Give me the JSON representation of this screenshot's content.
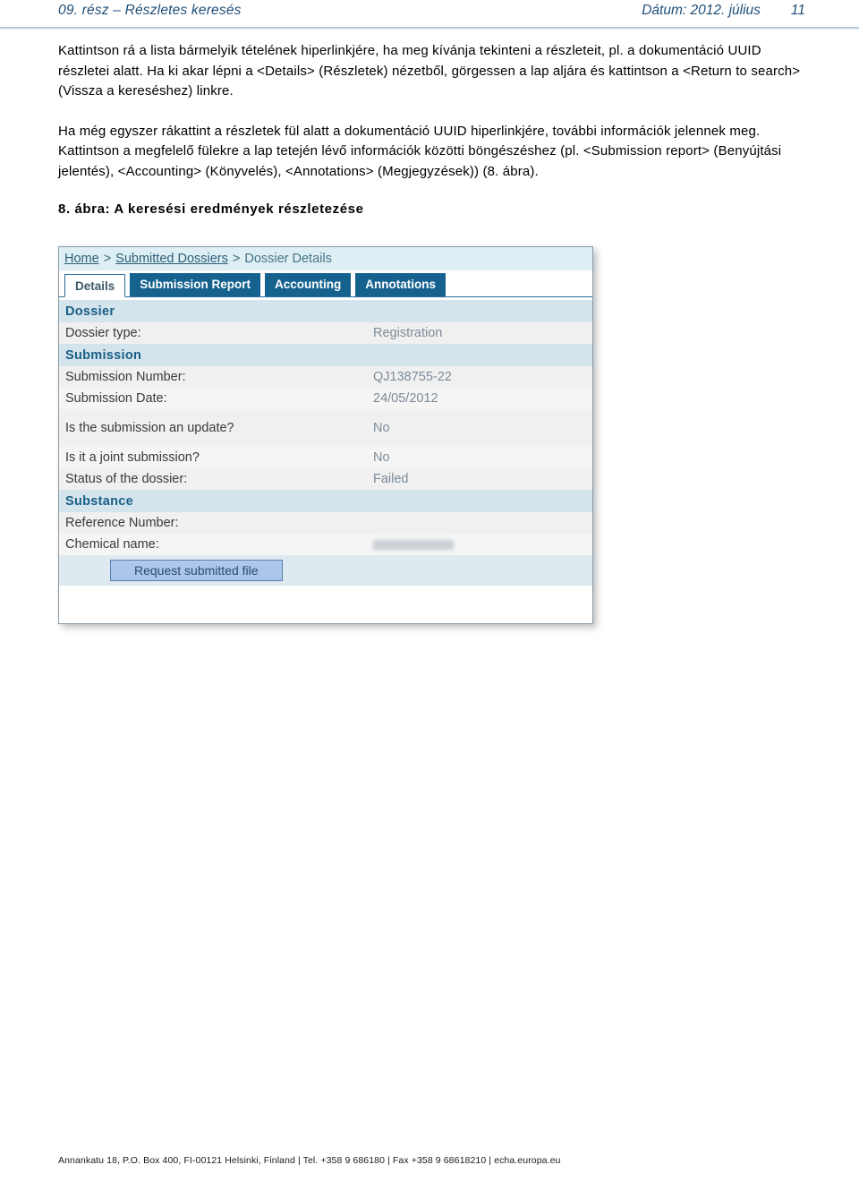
{
  "header": {
    "left_title": "09. rész – Részletes keresés",
    "date_label": "Dátum: 2012. július",
    "page_number": "11"
  },
  "body": {
    "paragraph_1": "Kattintson rá a lista bármelyik tételének hiperlinkjére, ha meg kívánja tekinteni a részleteit, pl. a dokumentáció UUID részletei alatt. Ha ki akar lépni a <Details> (Részletek) nézetből, görgessen a lap aljára és kattintson a <Return to search> (Vissza a kereséshez) linkre.",
    "paragraph_2": "Ha még egyszer rákattint a részletek fül alatt a dokumentáció UUID hiperlinkjére, további információk jelennek meg. Kattintson a megfelelő fülekre a lap tetején lévő információk közötti böngészéshez (pl. <Submission report> (Benyújtási jelentés), <Accounting> (Könyvelés), <Annotations> (Megjegyzések)) (8. ábra).",
    "figure_caption": "8. ábra: A keresési eredmények részletezése"
  },
  "screenshot": {
    "breadcrumb": {
      "items": [
        {
          "label": "Home",
          "is_link": true
        },
        {
          "label": "Submitted Dossiers",
          "is_link": true
        },
        {
          "label": "Dossier Details",
          "is_link": false
        }
      ],
      "separator": ">"
    },
    "tabs": [
      {
        "label": "Details",
        "active": true
      },
      {
        "label": "Submission Report",
        "active": false
      },
      {
        "label": "Accounting",
        "active": false
      },
      {
        "label": "Annotations",
        "active": false
      }
    ],
    "sections": [
      {
        "title": "Dossier",
        "rows": [
          {
            "label": "Dossier type:",
            "value": "Registration",
            "redacted": false
          }
        ]
      },
      {
        "title": "Submission",
        "rows": [
          {
            "label": "Submission Number:",
            "value": "QJ138755-22",
            "redacted": false
          },
          {
            "label": "Submission Date:",
            "value": "24/05/2012",
            "redacted": false
          },
          {
            "label": "Is the submission an update?",
            "value": "No",
            "redacted": false
          },
          {
            "label": "Is it a joint submission?",
            "value": "No",
            "redacted": false
          },
          {
            "label": "Status of the dossier:",
            "value": "Failed",
            "redacted": false
          }
        ]
      },
      {
        "title": "Substance",
        "rows": [
          {
            "label": "Reference Number:",
            "value": "",
            "redacted": false
          },
          {
            "label": "Chemical name:",
            "value": "",
            "redacted": true
          }
        ]
      }
    ],
    "request_button_label": "Request submitted file",
    "colors": {
      "tab_active_bg": "#ffffff",
      "tab_inactive_bg": "#16628f",
      "breadcrumb_bg": "#ddeef4",
      "section_row_bg": "#d3e4ec",
      "data_row_bg": "#f0f0f0",
      "button_bg": "#aec8ea"
    }
  },
  "footer": {
    "text": "Annankatu 18, P.O. Box 400, FI-00121 Helsinki, Finland | Tel. +358 9 686180 | Fax +358 9 68618210 | echa.europa.eu"
  }
}
